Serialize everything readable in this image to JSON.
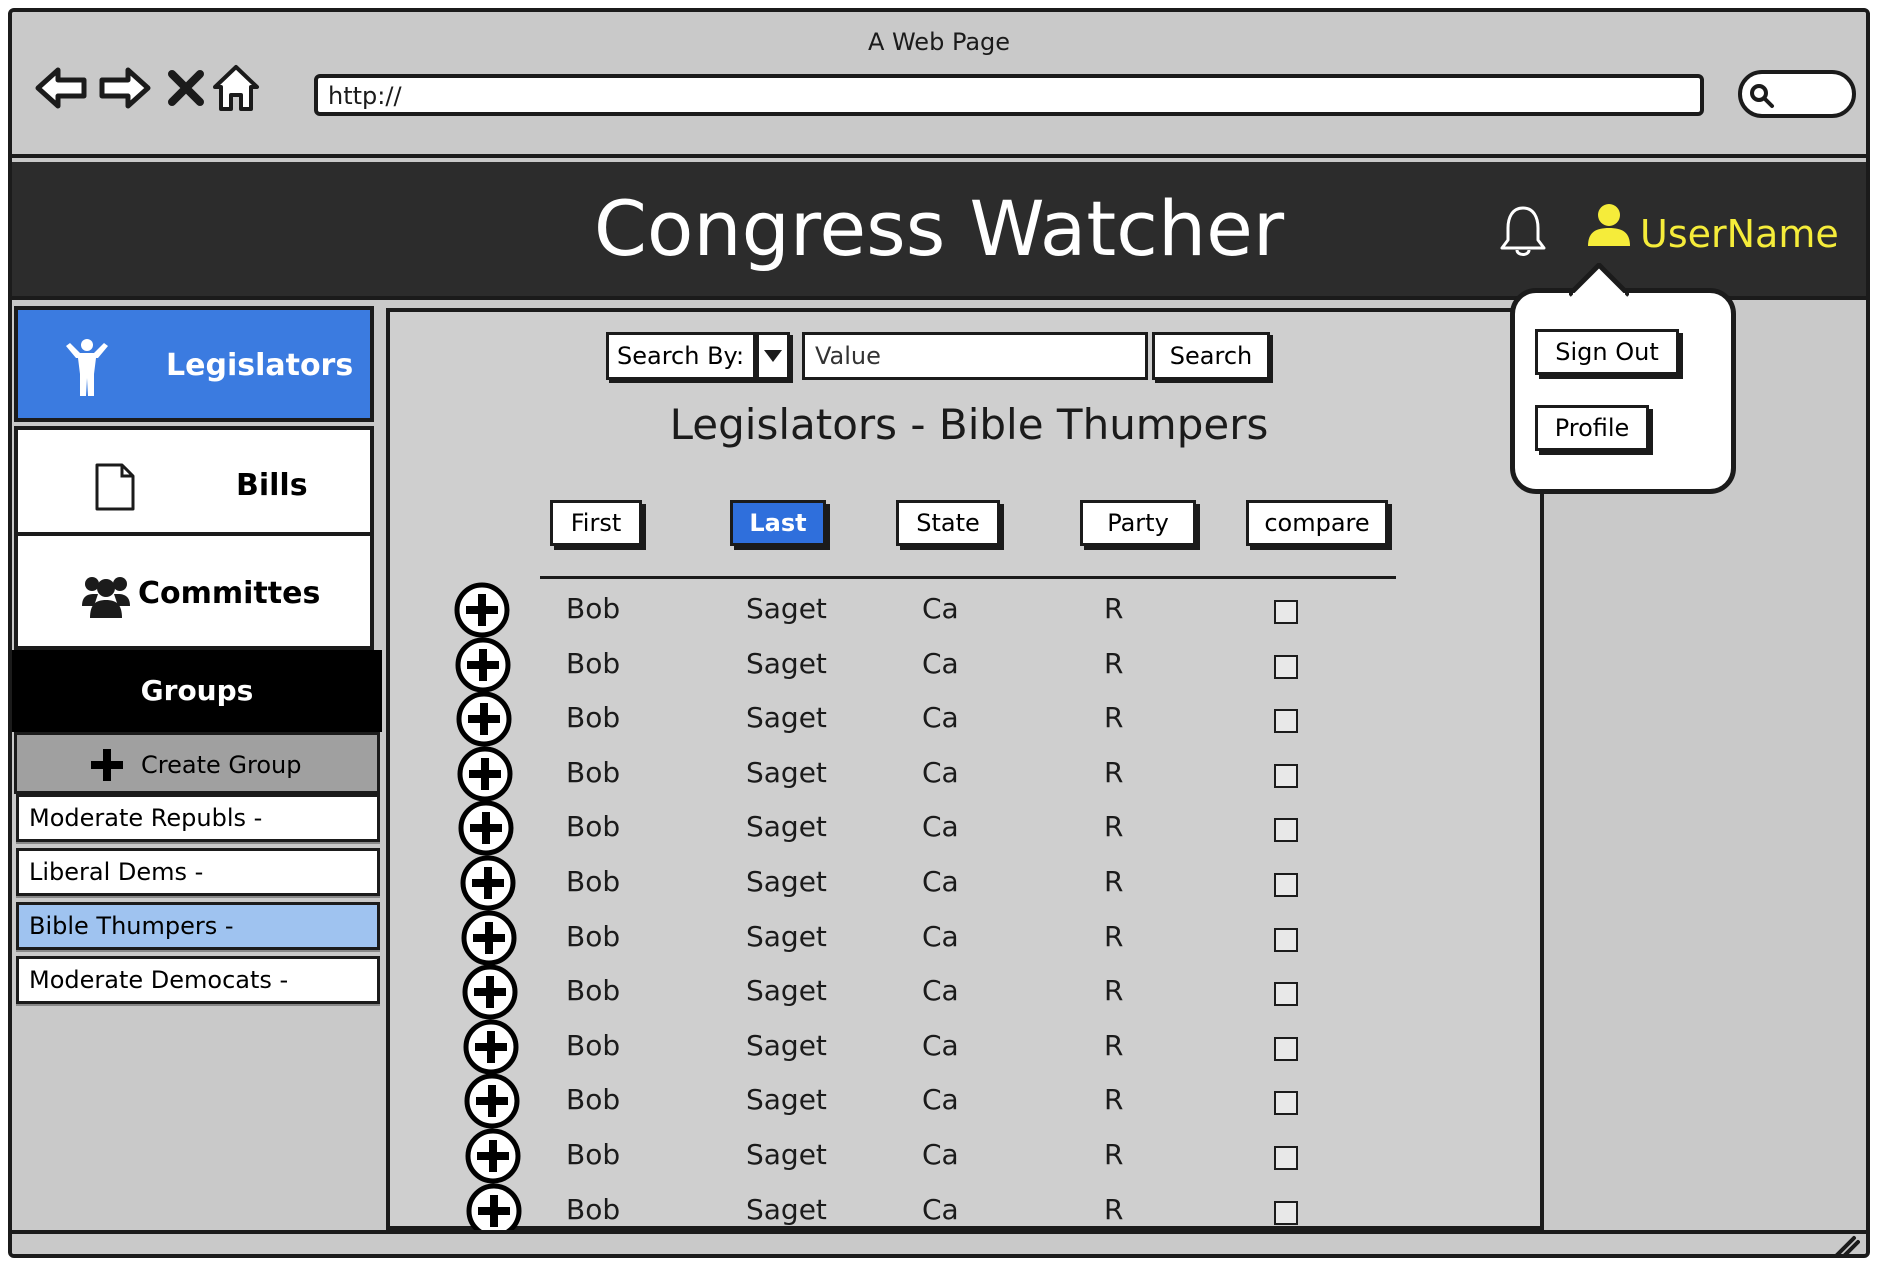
{
  "browser": {
    "window_title": "A Web Page",
    "url": "http://"
  },
  "header": {
    "title": "Congress Watcher",
    "username": "UserName"
  },
  "user_menu": {
    "sign_out": "Sign Out",
    "profile": "Profile"
  },
  "sidebar": {
    "nav": [
      {
        "label": "Legislators",
        "icon": "person-icon",
        "active": true
      },
      {
        "label": "Bills",
        "icon": "document-icon",
        "active": false
      },
      {
        "label": "Committes",
        "icon": "group-icon",
        "active": false
      }
    ],
    "groups_heading": "Groups",
    "create_group": "Create Group",
    "groups": [
      {
        "label": "Moderate Republs  -",
        "selected": false
      },
      {
        "label": "Liberal Dems -",
        "selected": false
      },
      {
        "label": "Bible Thumpers -",
        "selected": true
      },
      {
        "label": "Moderate Democats -",
        "selected": false
      }
    ]
  },
  "search": {
    "search_by_label": "Search By:",
    "value_placeholder": "Value",
    "search_button": "Search"
  },
  "main": {
    "title": "Legislators - Bible Thumpers",
    "columns": [
      {
        "label": "First",
        "active": false
      },
      {
        "label": "Last",
        "active": true
      },
      {
        "label": "State",
        "active": false
      },
      {
        "label": "Party",
        "active": false
      },
      {
        "label": "compare",
        "active": false
      }
    ],
    "rows": [
      {
        "first": "Bob",
        "last": "Saget",
        "state": "Ca",
        "party": "R"
      },
      {
        "first": "Bob",
        "last": "Saget",
        "state": "Ca",
        "party": "R"
      },
      {
        "first": "Bob",
        "last": "Saget",
        "state": "Ca",
        "party": "R"
      },
      {
        "first": "Bob",
        "last": "Saget",
        "state": "Ca",
        "party": "R"
      },
      {
        "first": "Bob",
        "last": "Saget",
        "state": "Ca",
        "party": "R"
      },
      {
        "first": "Bob",
        "last": "Saget",
        "state": "Ca",
        "party": "R"
      },
      {
        "first": "Bob",
        "last": "Saget",
        "state": "Ca",
        "party": "R"
      },
      {
        "first": "Bob",
        "last": "Saget",
        "state": "Ca",
        "party": "R"
      },
      {
        "first": "Bob",
        "last": "Saget",
        "state": "Ca",
        "party": "R"
      },
      {
        "first": "Bob",
        "last": "Saget",
        "state": "Ca",
        "party": "R"
      },
      {
        "first": "Bob",
        "last": "Saget",
        "state": "Ca",
        "party": "R"
      },
      {
        "first": "Bob",
        "last": "Saget",
        "state": "Ca",
        "party": "R"
      }
    ]
  },
  "colors": {
    "accent": "#2f6fdc",
    "header_bg": "#2c2c2c",
    "username": "#f5ec3a",
    "selected_group": "#9fc3f0"
  }
}
